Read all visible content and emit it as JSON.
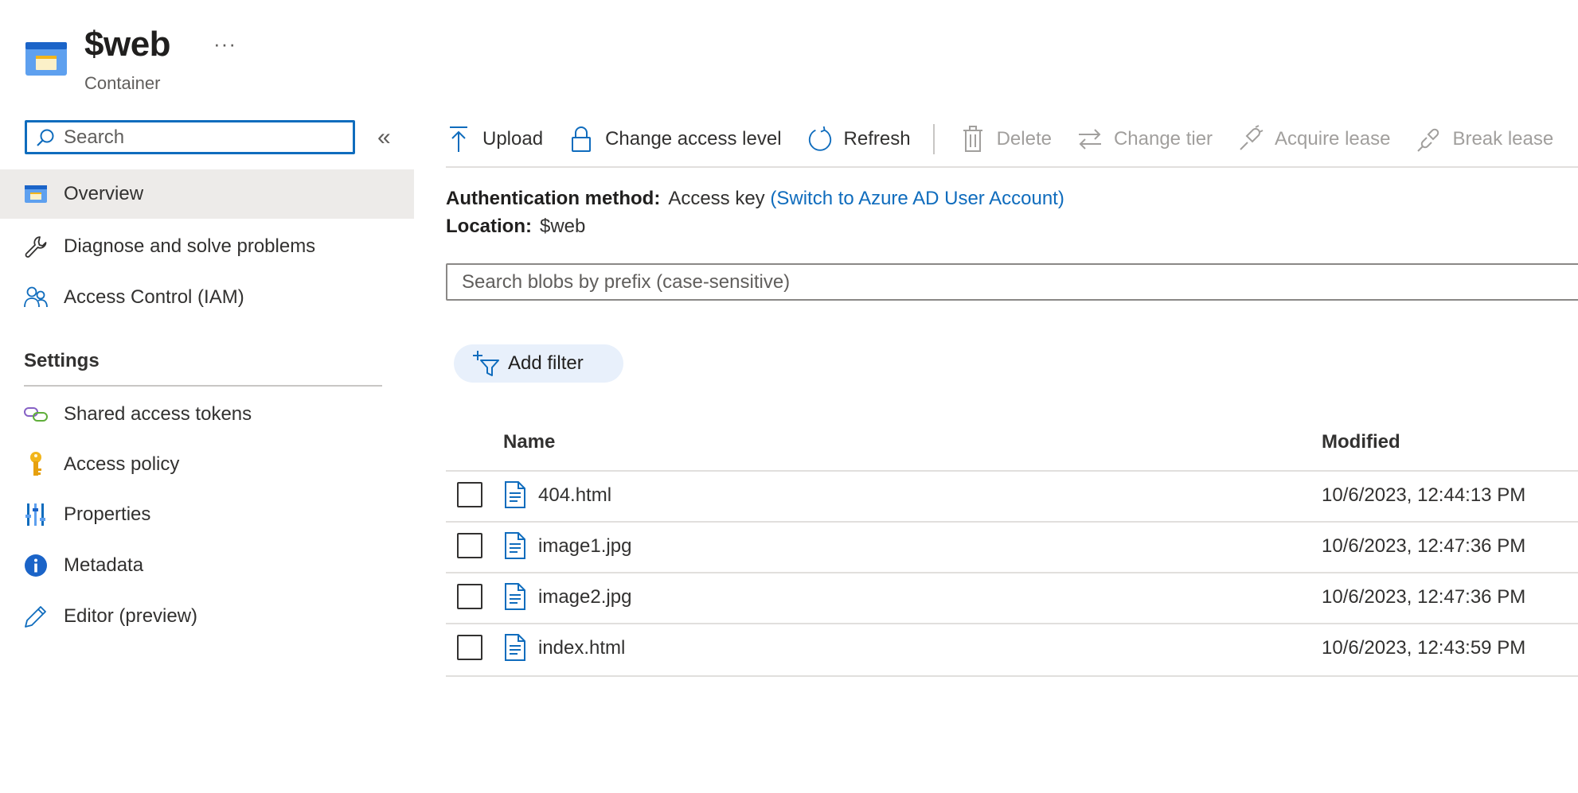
{
  "header": {
    "title": "$web",
    "subtitle": "Container",
    "more_label": "···"
  },
  "sidebar": {
    "search_placeholder": "Search",
    "collapse_label": "«",
    "items": [
      {
        "label": "Overview",
        "icon": "container-icon",
        "selected": true
      },
      {
        "label": "Diagnose and solve problems",
        "icon": "wrench-icon"
      },
      {
        "label": "Access Control (IAM)",
        "icon": "people-icon"
      }
    ],
    "settings_title": "Settings",
    "settings_items": [
      {
        "label": "Shared access tokens",
        "icon": "link-icon"
      },
      {
        "label": "Access policy",
        "icon": "key-icon"
      },
      {
        "label": "Properties",
        "icon": "properties-icon"
      },
      {
        "label": "Metadata",
        "icon": "info-icon"
      },
      {
        "label": "Editor (preview)",
        "icon": "pencil-icon"
      }
    ]
  },
  "toolbar": {
    "upload": "Upload",
    "change_access_level": "Change access level",
    "refresh": "Refresh",
    "delete": "Delete",
    "change_tier": "Change tier",
    "acquire_lease": "Acquire lease",
    "break_lease": "Break lease"
  },
  "info": {
    "auth_label": "Authentication method:",
    "auth_value": "Access key",
    "auth_link": "(Switch to Azure AD User Account)",
    "location_label": "Location:",
    "location_value": "$web"
  },
  "blob_search": {
    "placeholder": "Search blobs by prefix (case-sensitive)"
  },
  "filter": {
    "add_filter": "Add filter"
  },
  "table": {
    "columns": [
      "Name",
      "Modified"
    ],
    "rows": [
      {
        "name": "404.html",
        "modified": "10/6/2023, 12:44:13 PM"
      },
      {
        "name": "image1.jpg",
        "modified": "10/6/2023, 12:47:36 PM"
      },
      {
        "name": "image2.jpg",
        "modified": "10/6/2023, 12:47:36 PM"
      },
      {
        "name": "index.html",
        "modified": "10/6/2023, 12:43:59 PM"
      }
    ]
  },
  "colors": {
    "accent": "#0f6cbd",
    "selected_bg": "#edebe9",
    "disabled_text": "#a19f9d",
    "key_yellow": "#f2b51b",
    "link_green": "#5fae3a"
  }
}
